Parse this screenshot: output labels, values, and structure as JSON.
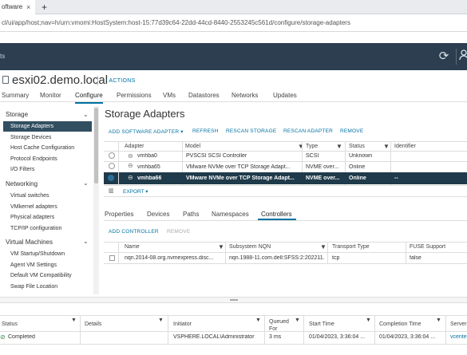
{
  "browser": {
    "tab_title": "oftware",
    "tab_close": "×",
    "new_tab": "+",
    "url": "cl/ui/app/host;nav=h/urn:vmomi:HostSystem:host-15:77d39c64-22dd-44cd-8440-2553245c561d/configure/storage-adapters"
  },
  "app": {
    "title": "ts",
    "refresh_icon": "⟳",
    "user_icon": "👤"
  },
  "object": {
    "name": "esxi02.demo.local",
    "actions": "⁝ ACTIONS"
  },
  "tabs": [
    "Summary",
    "Monitor",
    "Configure",
    "Permissions",
    "VMs",
    "Datastores",
    "Networks",
    "Updates"
  ],
  "nav": {
    "storage": {
      "label": "Storage",
      "items": [
        "Storage Adapters",
        "Storage Devices",
        "Host Cache Configuration",
        "Protocol Endpoints",
        "I/O Filters"
      ]
    },
    "networking": {
      "label": "Networking",
      "items": [
        "Virtual switches",
        "VMkernel adapters",
        "Physical adapters",
        "TCP/IP configuration"
      ]
    },
    "vms": {
      "label": "Virtual Machines",
      "items": [
        "VM Startup/Shutdown",
        "Agent VM Settings",
        "Default VM Compatibility",
        "Swap File Location"
      ]
    }
  },
  "page": {
    "title": "Storage Adapters",
    "toolbar": [
      "ADD SOFTWARE ADAPTER ▾",
      "REFRESH",
      "RESCAN STORAGE",
      "RESCAN ADAPTER",
      "REMOVE"
    ]
  },
  "adapters": {
    "headers": [
      "Adapter",
      "Model",
      "Type",
      "Status",
      "Identifier"
    ],
    "rows": [
      {
        "adapter": "vmhba0",
        "model": "PVSCSI SCSI Controller",
        "type": "SCSI",
        "status": "Unknown",
        "identifier": ""
      },
      {
        "adapter": "vmhba65",
        "model": "VMware NVMe over TCP Storage Adapt...",
        "type": "NVME over...",
        "status": "Online",
        "identifier": ""
      },
      {
        "adapter": "vmhba66",
        "model": "VMware NVMe over TCP Storage Adapt...",
        "type": "NVME over...",
        "status": "Online",
        "identifier": "--"
      }
    ],
    "export": "EXPORT ▾"
  },
  "details": {
    "tabs": [
      "Properties",
      "Devices",
      "Paths",
      "Namespaces",
      "Controllers"
    ],
    "add_controller": "ADD CONTROLLER",
    "remove": "REMOVE",
    "headers": [
      "Name",
      "Subsystem NQN",
      "Transport Type",
      "FUSE Support"
    ],
    "rows": [
      {
        "name": "nqn.2014-08.org.nvmexpress.disc...",
        "nqn": "nqn.1988-11.com.dell:SFSS:2:202211...",
        "transport": "tcp",
        "fuse": "false"
      }
    ]
  },
  "tasks": {
    "headers": [
      "Status",
      "Details",
      "Initiator",
      "Queued For",
      "Start Time",
      "Completion Time",
      "Server"
    ],
    "rows": [
      {
        "status": "Completed",
        "details": "",
        "initiator": "VSPHERE.LOCAL\\Administrator",
        "queued": "3 ms",
        "start": "01/04/2023, 3:36:04 ...",
        "completion": "01/04/2023, 3:36:04 ...",
        "server": "vcente"
      }
    ]
  },
  "colors": {
    "header_bg": "#2c3e50",
    "accent": "#0072a3",
    "selected_row": "#1f3a4a"
  }
}
